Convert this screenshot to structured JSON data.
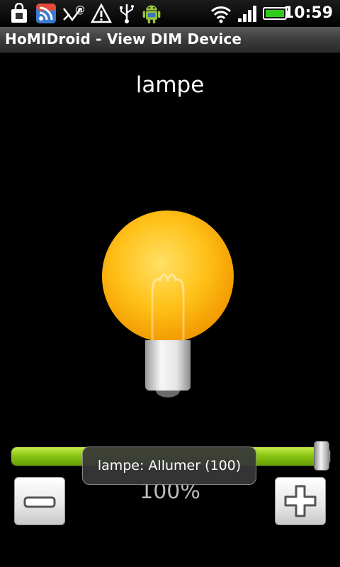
{
  "status_bar": {
    "time": "10:59",
    "icons": [
      "shopping-bag-icon",
      "rss-icon",
      "missed-email-icon",
      "warning-icon",
      "usb-icon",
      "android-debug-icon",
      "wifi-icon",
      "signal-icon",
      "battery-icon"
    ]
  },
  "app": {
    "title": "HoMIDroid - View DIM Device"
  },
  "device": {
    "name": "lampe",
    "level_percent": 100,
    "level_label": "100%",
    "toast": "lampe: Allumer (100)"
  },
  "colors": {
    "slider_fill": "#8cc614",
    "bulb": "#ffb000"
  }
}
